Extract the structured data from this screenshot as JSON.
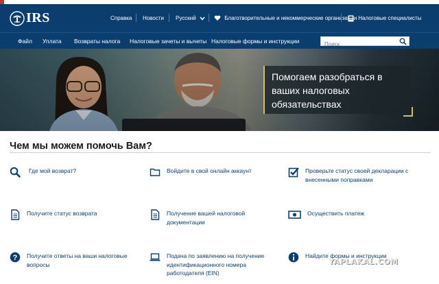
{
  "header": {
    "logo_text": "IRS",
    "logo_icon": "irs-eagle-icon",
    "utility_links": [
      "Справка",
      "Новости"
    ],
    "language": "Русский",
    "charities_link": "Благотворительные и некоммерческие организации",
    "tax_pros_link": "Налоговые специалисты",
    "colors": {
      "header_bg": "#0b3e6f",
      "accent": "#d9b878"
    }
  },
  "nav": {
    "items": [
      "Файл",
      "Уплата",
      "Возвраты налога",
      "Налоговые зачеты и вычеты",
      "Налоговые формы и инструкции"
    ],
    "search_placeholder": "Поиск"
  },
  "hero": {
    "callout": "Помогаем разобраться в ваших налоговых обязательствах"
  },
  "help": {
    "title": "Чем мы можем помочь Вам?",
    "items": [
      {
        "label": "Где мой возврат?",
        "icon": "search-icon"
      },
      {
        "label": "Войдите в свой онлайн аккаунт",
        "icon": "folder-icon"
      },
      {
        "label": "Проверьте статус своей декларации с внесенными поправками",
        "icon": "checkbox-icon"
      },
      {
        "label": "Получите статус возврата",
        "icon": "document-icon"
      },
      {
        "label": "Получение вашей налоговой документации",
        "icon": "document-icon"
      },
      {
        "label": "Осуществить платеж",
        "icon": "banknote-icon"
      },
      {
        "label": "Получите ответы на ваши налоговые вопросы",
        "icon": "question-icon"
      },
      {
        "label": "Подача по заявлению на получение идентификационного номера работодателя (EIN)",
        "icon": "laptop-icon"
      },
      {
        "label": "Найдите формы и инструкции",
        "icon": "info-icon"
      }
    ]
  },
  "watermark": "YAPLAKAL.COM"
}
